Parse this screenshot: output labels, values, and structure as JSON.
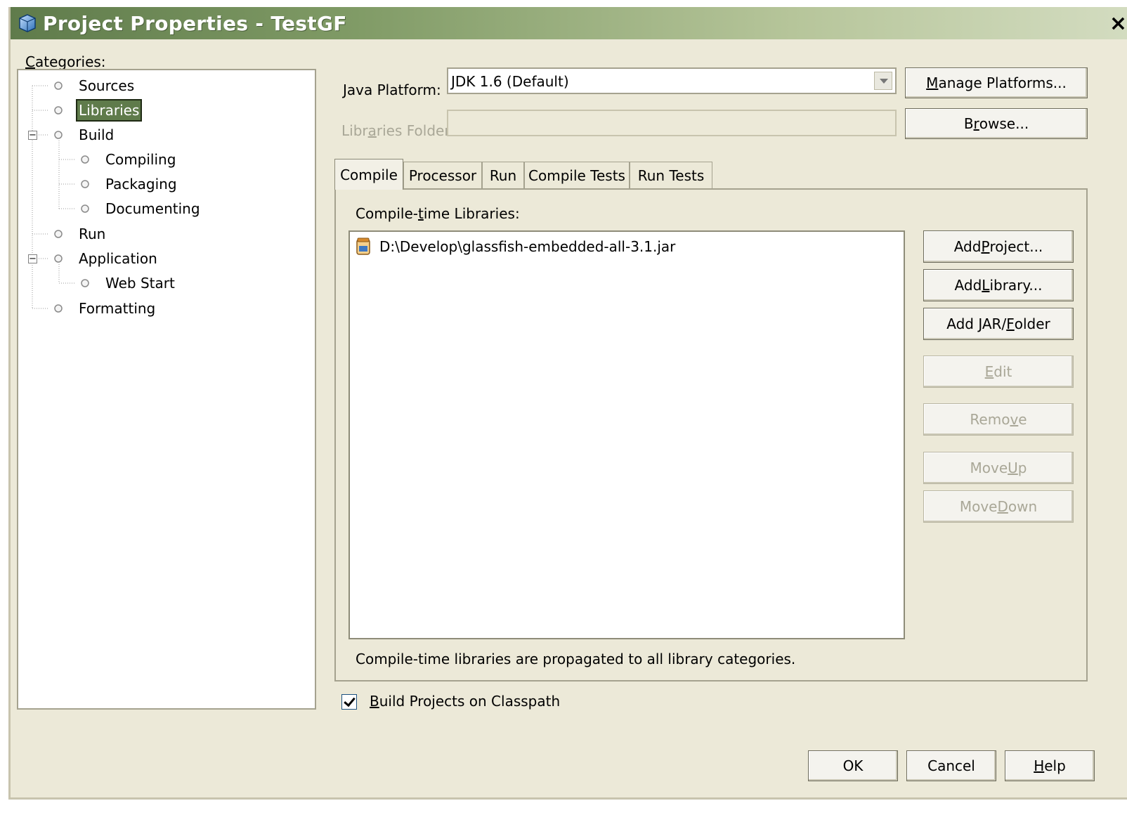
{
  "window": {
    "title": "Project Properties - TestGF",
    "close_glyph": "×"
  },
  "categories": {
    "label_mnemonic": "C",
    "label_rest": "ategories:",
    "items": [
      {
        "label": "Sources"
      },
      {
        "label": "Libraries",
        "selected": true
      },
      {
        "label": "Build"
      },
      {
        "label": "Compiling"
      },
      {
        "label": "Packaging"
      },
      {
        "label": "Documenting"
      },
      {
        "label": "Run"
      },
      {
        "label": "Application"
      },
      {
        "label": "Web Start"
      },
      {
        "label": "Formatting"
      }
    ]
  },
  "platform": {
    "label_mnemonic": "J",
    "label_rest": "ava Platform:",
    "value": "JDK 1.6 (Default)",
    "manage": {
      "pre": "",
      "mn": "M",
      "post": "anage Platforms..."
    }
  },
  "libraries_folder": {
    "label_pre": "Libr",
    "label_mn": "a",
    "label_post": "ries Folder:",
    "value": "",
    "browse": {
      "pre": "B",
      "mn": "r",
      "post": "owse..."
    }
  },
  "tabs": [
    {
      "label": "Compile",
      "active": true
    },
    {
      "label": "Processor"
    },
    {
      "label": "Run"
    },
    {
      "label": "Compile Tests"
    },
    {
      "label": "Run Tests"
    }
  ],
  "compile": {
    "libs_label_pre": "Compile-",
    "libs_label_mn": "t",
    "libs_label_post": "ime Libraries:",
    "items": [
      "D:\\Develop\\glassfish-embedded-all-3.1.jar"
    ],
    "note": "Compile-time libraries are propagated to all library categories.",
    "buttons": [
      {
        "pre": "Add ",
        "mn": "P",
        "post": "roject...",
        "enabled": true
      },
      {
        "pre": "Add ",
        "mn": "L",
        "post": "ibrary...",
        "enabled": true
      },
      {
        "pre": "Add JAR/",
        "mn": "F",
        "post": "older",
        "enabled": true
      },
      {
        "pre": "",
        "mn": "E",
        "post": "dit",
        "enabled": false
      },
      {
        "pre": "Remo",
        "mn": "v",
        "post": "e",
        "enabled": false
      },
      {
        "pre": "Move ",
        "mn": "U",
        "post": "p",
        "enabled": false
      },
      {
        "pre": "Move ",
        "mn": "D",
        "post": "own",
        "enabled": false
      }
    ]
  },
  "build_on_classpath": {
    "checked": true,
    "mn": "B",
    "rest": "uild Projects on Classpath"
  },
  "dialog_buttons": {
    "ok": "OK",
    "cancel": "Cancel",
    "help_mn": "H",
    "help_rest": "elp"
  }
}
